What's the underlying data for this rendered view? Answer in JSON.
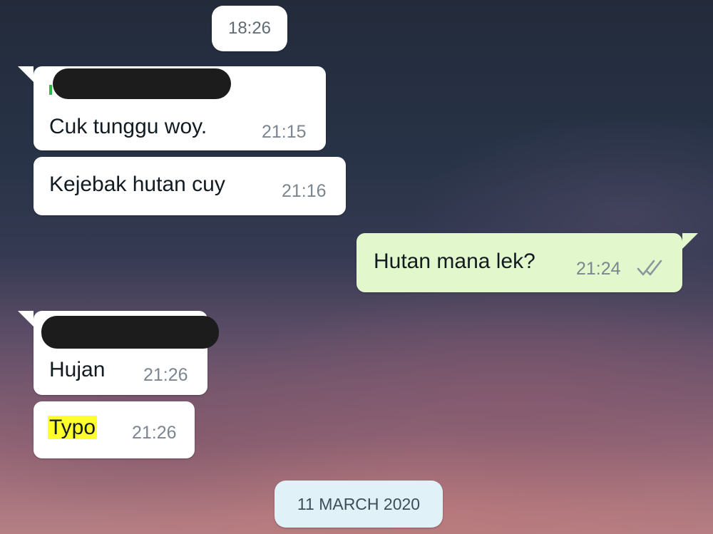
{
  "chat": {
    "time_divider": "18:26",
    "date_divider": "11 MARCH 2020",
    "messages": [
      {
        "direction": "incoming",
        "sender_redacted": true,
        "text": "Cuk tunggu woy.",
        "time": "21:15"
      },
      {
        "direction": "incoming",
        "text": "Kejebak hutan cuy",
        "time": "21:16"
      },
      {
        "direction": "outgoing",
        "text": "Hutan mana lek?",
        "time": "21:24",
        "status_icon": "double-check-icon"
      },
      {
        "direction": "incoming",
        "sender_redacted": true,
        "text": "Hujan",
        "time": "21:26"
      },
      {
        "direction": "incoming",
        "text": "Typo",
        "time": "21:26",
        "text_highlight": "#ffff2e"
      }
    ]
  },
  "colors": {
    "incoming_bubble": "#ffffff",
    "outgoing_bubble": "#e2f7cb",
    "sender_name_accent": "#2db84a",
    "date_pill": "#e1f1f8",
    "redaction": "#1c1c1c"
  }
}
